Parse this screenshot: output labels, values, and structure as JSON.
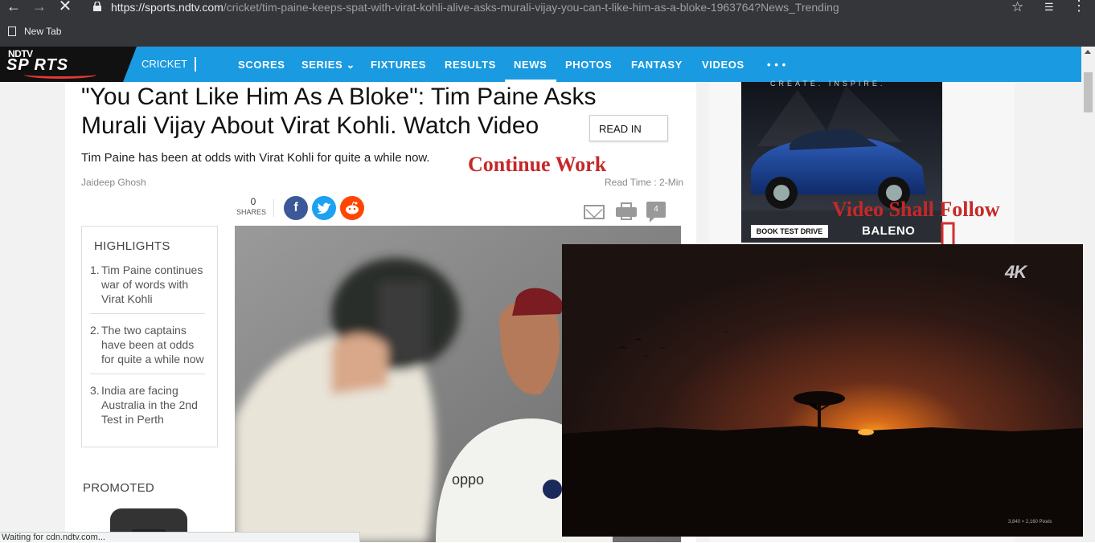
{
  "browser": {
    "url_host": "https://sports.ndtv.com",
    "url_path": "/cricket/tim-paine-keeps-spat-with-virat-kohli-alive-asks-murali-vijay-you-can-t-like-him-as-a-bloke-1963764?News_Trending",
    "bookmark": "New Tab",
    "status_text": "Waiting for cdn.ndtv.com..."
  },
  "site": {
    "logo_top": "NDTV",
    "logo_bottom": "SP  RTS",
    "section": "CRICKET",
    "nav": [
      "SCORES",
      "SERIES",
      "FIXTURES",
      "RESULTS",
      "NEWS",
      "PHOTOS",
      "FANTASY",
      "VIDEOS",
      "• • •"
    ],
    "active_nav": "NEWS"
  },
  "article": {
    "headline": "\"You Cant Like Him As A Bloke\": Tim Paine Asks Murali Vijay About Virat Kohli. Watch Video",
    "read_in_label": "READ IN",
    "summary": "Tim Paine has been at odds with Virat Kohli for quite a while now.",
    "author": "Jaideep Ghosh",
    "read_time": "Read Time : 2-Min",
    "shares_count": "0",
    "shares_label": "SHARES",
    "comment_count": "4",
    "highlights_title": "HIGHLIGHTS",
    "highlights": [
      {
        "num": "1.",
        "text": "Tim Paine continues war of words with Virat Kohli"
      },
      {
        "num": "2.",
        "text": "The two captains have been at odds for quite a while now"
      },
      {
        "num": "3.",
        "text": "India are facing Australia in the 2nd Test in Perth"
      }
    ],
    "promoted_label": "PROMOTED",
    "photo_jersey_text": "oppo"
  },
  "annotations": {
    "continue_work": "Continue Work",
    "video_follow": "Video Shall Follow",
    "accent_color": "#c62828"
  },
  "ad": {
    "tagline": "CREATE. INSPIRE.",
    "button": "BOOK TEST DRIVE",
    "brand": "BALENO"
  },
  "video": {
    "badge": "4K",
    "resolution": "3,840 × 2,160 Pixels"
  },
  "colors": {
    "nav_blue": "#1a9ae0",
    "chrome_dark": "#35363a",
    "facebook": "#3b5998",
    "twitter": "#1da1f2",
    "reddit": "#ff4500"
  }
}
